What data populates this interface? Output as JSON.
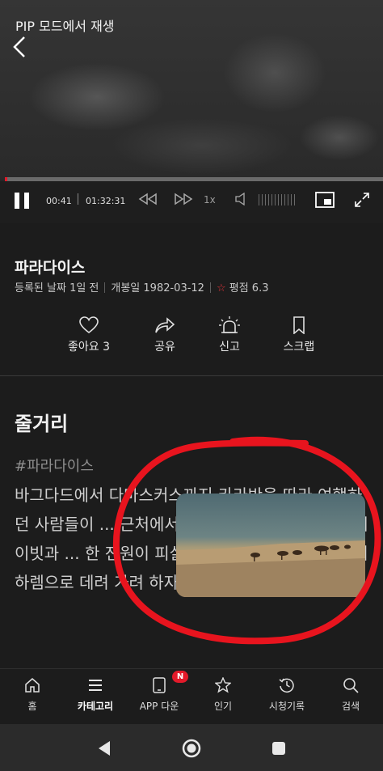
{
  "player": {
    "pip_label": "PIP 모드에서 재생",
    "current_time": "00:41",
    "total_time": "01:32:31",
    "playback_rate": "1x",
    "progress_fraction": 0.0074
  },
  "movie": {
    "title": "파라다이스",
    "registered": "등록된 날짜 1일 전",
    "release": "개봉일 1982-03-12",
    "rating": "평점 6.3"
  },
  "actions": [
    {
      "label": "좋아요 3",
      "icon": "heart-icon"
    },
    {
      "label": "공유",
      "icon": "share-icon"
    },
    {
      "label": "신고",
      "icon": "siren-icon"
    },
    {
      "label": "스크랩",
      "icon": "bookmark-icon"
    }
  ],
  "synopsis": {
    "title": "줄거리",
    "hashtag": "#파라다이스",
    "text": "바그다드에서 다마스커스까지 카라반을 따라 여행하던 사람들이 ... 근처에서 '자칼' 일당 ... 미국 소년 데이빗과 ... 한 전원이 피살된다. 재칼이 새라를 자신의 하렘으로 데려 가려 하자, 둘은 도망쳐 사막"
  },
  "tabs": [
    {
      "label": "홈",
      "icon": "home-icon"
    },
    {
      "label": "카테고리",
      "icon": "menu-icon",
      "active": true
    },
    {
      "label": "APP 다운",
      "icon": "tablet-icon",
      "badge": "N"
    },
    {
      "label": "인기",
      "icon": "star-icon"
    },
    {
      "label": "시청기록",
      "icon": "history-icon"
    },
    {
      "label": "검색",
      "icon": "search-icon"
    }
  ],
  "colors": {
    "accent_red": "#e21a2a",
    "annotation_red": "#e8141e",
    "background": "#1c1c1c"
  }
}
